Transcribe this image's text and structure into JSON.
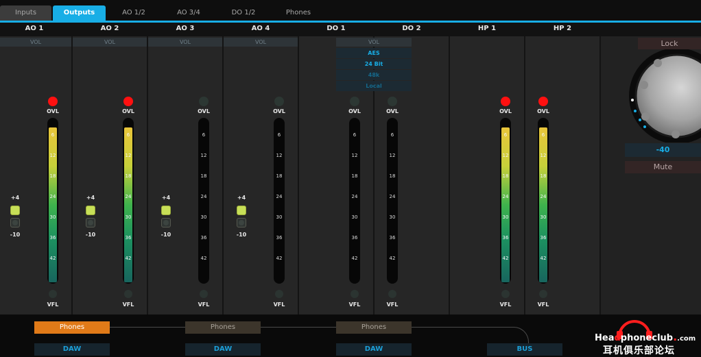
{
  "tabs": [
    {
      "label": "Inputs",
      "active": false
    },
    {
      "label": "Outputs",
      "active": true
    },
    {
      "label": "AO 1/2",
      "active": false
    },
    {
      "label": "AO 3/4",
      "active": false
    },
    {
      "label": "DO 1/2",
      "active": false
    },
    {
      "label": "Phones",
      "active": false
    }
  ],
  "channels": [
    {
      "name": "AO 1",
      "vol": "VOL",
      "ovl_active": true,
      "filled": true,
      "trim": true
    },
    {
      "name": "AO 2",
      "vol": "VOL",
      "ovl_active": true,
      "filled": true,
      "trim": true
    },
    {
      "name": "AO 3",
      "vol": "VOL",
      "ovl_active": false,
      "filled": false,
      "trim": true
    },
    {
      "name": "AO 4",
      "vol": "VOL",
      "ovl_active": false,
      "filled": false,
      "trim": true
    },
    {
      "name": "DO 1",
      "ovl_active": false,
      "filled": false,
      "trim": false
    },
    {
      "name": "DO 2",
      "ovl_active": false,
      "filled": false,
      "trim": false
    },
    {
      "name": "HP 1",
      "ovl_active": true,
      "filled": true,
      "trim": false
    },
    {
      "name": "HP 2",
      "ovl_active": true,
      "filled": true,
      "trim": false
    }
  ],
  "digital_info": {
    "vol": "VOL",
    "format": "AES",
    "bit_depth": "24 Bit",
    "rate": "48k",
    "clock": "Local"
  },
  "meter_labels": {
    "ovl": "OVL",
    "vfl": "VFL",
    "ticks": [
      "6",
      "12",
      "18",
      "24",
      "30",
      "36",
      "42"
    ]
  },
  "trim": {
    "plus": "+4",
    "minus": "-10"
  },
  "routing": {
    "phones_buttons": [
      {
        "label": "Phones",
        "active": true
      },
      {
        "label": "Phones",
        "active": false
      },
      {
        "label": "Phones",
        "active": false
      }
    ],
    "source_buttons": [
      "DAW",
      "DAW",
      "DAW",
      "BUS"
    ]
  },
  "monitor": {
    "lock_label": "Lock",
    "value": "-40",
    "mute_label": "Mute"
  },
  "watermark": {
    "site_prefix": "Hea",
    "site_suffix": "phoneclub",
    "site_tld": ".com",
    "cn_name": "耳机俱乐部论坛"
  },
  "colors": {
    "accent": "#18aee6",
    "ovl_red": "#ff1010",
    "phones_active": "#e07a18",
    "trim_on": "#c7df57"
  }
}
